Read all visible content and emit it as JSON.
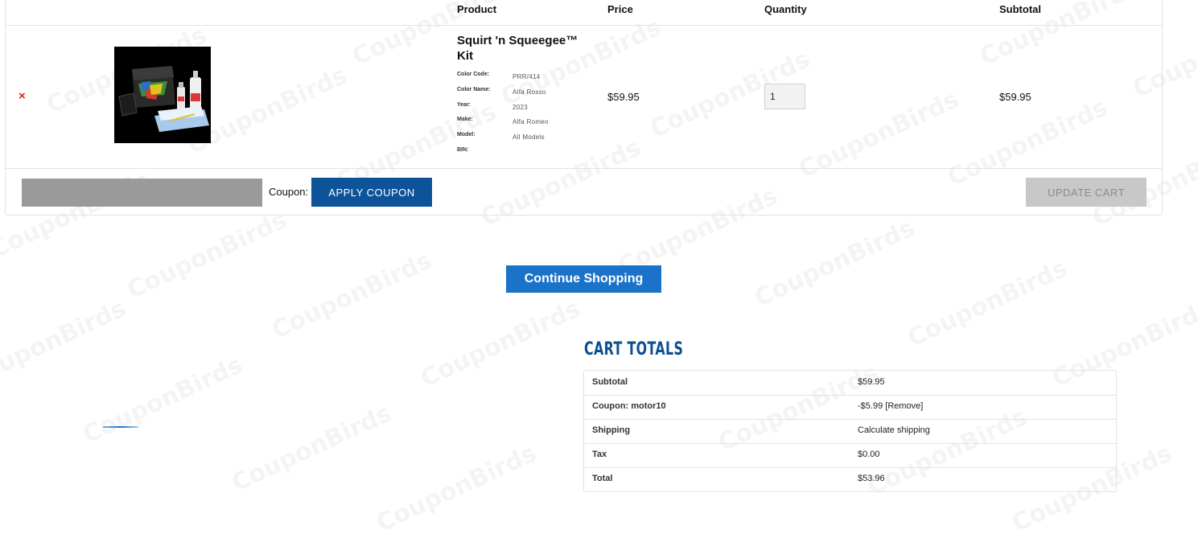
{
  "watermark": "CouponBirds",
  "cart": {
    "headers": {
      "product": "Product",
      "price": "Price",
      "quantity": "Quantity",
      "subtotal": "Subtotal"
    },
    "item": {
      "remove_glyph": "×",
      "name": "Squirt 'n Squeegee™ Kit",
      "meta": [
        {
          "key": "Color Code:",
          "value": "PRR/414"
        },
        {
          "key": "Color Name:",
          "value": "Alfa Rosso"
        },
        {
          "key": "Year:",
          "value": "2023"
        },
        {
          "key": "Make:",
          "value": "Alfa Romeo"
        },
        {
          "key": "Model:",
          "value": "All Models"
        },
        {
          "key": "BIN:",
          "value": ""
        }
      ],
      "price": "$59.95",
      "quantity": "1",
      "subtotal": "$59.95"
    },
    "coupon_label": "Coupon:",
    "apply_coupon": "APPLY COUPON",
    "update_cart": "UPDATE CART"
  },
  "continue_shopping": "Continue Shopping",
  "totals": {
    "title": "CART TOTALS",
    "rows": [
      {
        "label": "Subtotal",
        "value": "$59.95"
      },
      {
        "label": "Coupon: motor10",
        "value": "-$5.99",
        "link": "[Remove]"
      },
      {
        "label": "Shipping",
        "value": "Calculate shipping"
      },
      {
        "label": "Tax",
        "value": "$0.00"
      },
      {
        "label": "Total",
        "value": "$53.96"
      }
    ]
  },
  "colors": {
    "primary_blue": "#0d5399",
    "continue_blue": "#1a73c8",
    "title_blue": "#0d4f8f",
    "remove_red": "#e2231a"
  }
}
